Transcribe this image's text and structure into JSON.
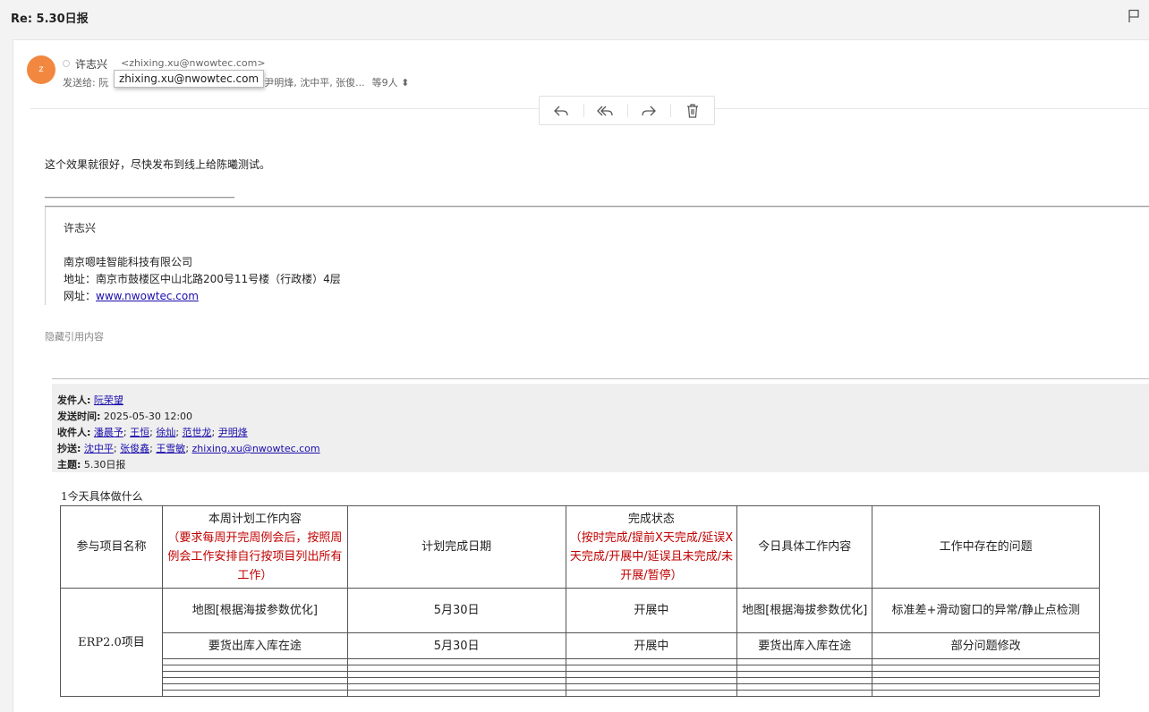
{
  "subject": "Re: 5.30日报",
  "sender": {
    "avatar_initial": "z",
    "name": "许志兴",
    "email": "<zhixing.xu@nwowtec.com>",
    "tooltip_email": "zhixing.xu@nwowtec.com",
    "to_label": "发送给: 阮",
    "to_rest": "龙, 尹明烽, 沈中平, 张俊...",
    "to_more": "等9人 ⬍"
  },
  "body": {
    "text": "这个效果就很好，尽快发布到线上给陈曦测试。"
  },
  "signature": {
    "name": "许志兴",
    "company": "南京嗯哇智能科技有限公司",
    "address": "地址：南京市鼓楼区中山北路200号11号楼（行政楼）4层",
    "website_label": "网址：",
    "website": "www.nwowtec.com"
  },
  "hidden_quote": "隐藏引用内容",
  "quoted": {
    "from_label": "发件人:",
    "from": "阮荣望",
    "sent_label": "发送时间:",
    "sent": "2025-05-30 12:00",
    "to_label": "收件人:",
    "to": [
      "潘晨予",
      "王恒",
      "徐灿",
      "范世龙",
      "尹明烽"
    ],
    "cc_label": "抄送:",
    "cc": [
      "沈中平",
      "张俊鑫",
      "王雪敏",
      "zhixing.xu@nwowtec.com"
    ],
    "subject_label": "主题:",
    "subject": "5.30日报"
  },
  "section_title": "1今天具体做什么",
  "table": {
    "headers": {
      "project": "参与项目名称",
      "plan": "本周计划工作内容",
      "plan_note": "（要求每周开完周例会后，按照周例会工作安排自行按项目列出所有工作）",
      "date": "计划完成日期",
      "status": "完成状态",
      "status_note": "（按时完成/提前X天完成/延误X天完成/开展中/延误且未完成/未开展/暂停）",
      "today": "今日具体工作内容",
      "issues": "工作中存在的问题"
    },
    "project": "ERP2.0项目",
    "rows": [
      {
        "plan": "地图[根据海拔参数优化]",
        "date": "5月30日",
        "status": "开展中",
        "today": "地图[根据海拔参数优化]",
        "issue": "标准差+滑动窗口的异常/静止点检测"
      },
      {
        "plan": "要货出库入库在途",
        "date": "5月30日",
        "status": "开展中",
        "today": "要货出库入库在途",
        "issue": "部分问题修改"
      }
    ]
  },
  "colors": {
    "avatar": "#f2883f",
    "link": "#1a0dab",
    "note_red": "#c00000"
  },
  "icons": [
    "flag-icon",
    "reply-icon",
    "reply-all-icon",
    "forward-icon",
    "delete-icon"
  ]
}
